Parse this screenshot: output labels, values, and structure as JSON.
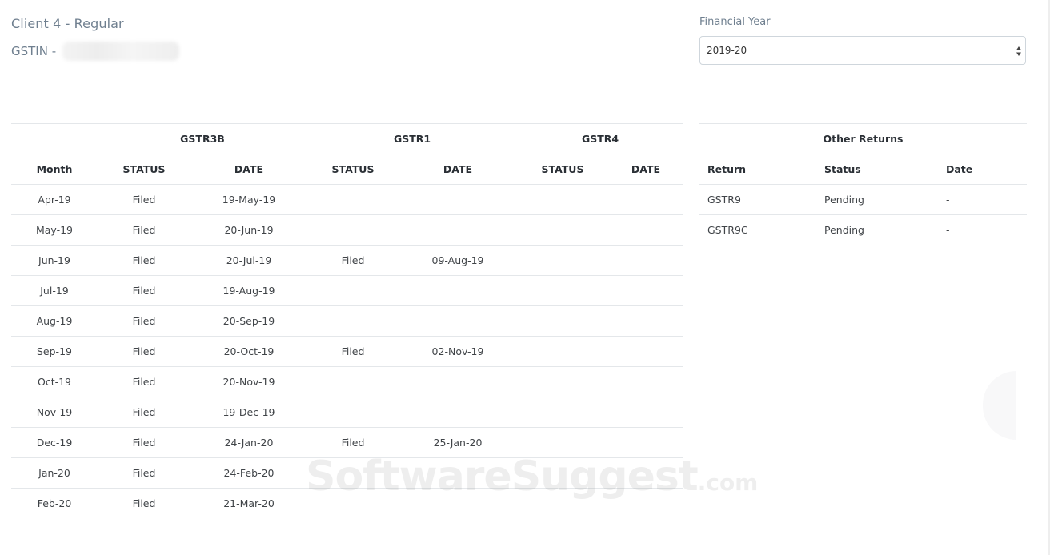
{
  "client": {
    "title": "Client 4 - Regular",
    "gstin_label": "GSTIN -"
  },
  "financial_year": {
    "label": "Financial Year",
    "selected": "2019-20"
  },
  "gst_table": {
    "groups": [
      "GSTR3B",
      "GSTR1",
      "GSTR4"
    ],
    "columns": [
      "Month",
      "STATUS",
      "DATE",
      "STATUS",
      "DATE",
      "STATUS",
      "DATE"
    ],
    "rows": [
      [
        "Apr-19",
        "Filed",
        "19-May-19",
        "",
        "",
        "",
        ""
      ],
      [
        "May-19",
        "Filed",
        "20-Jun-19",
        "",
        "",
        "",
        ""
      ],
      [
        "Jun-19",
        "Filed",
        "20-Jul-19",
        "Filed",
        "09-Aug-19",
        "",
        ""
      ],
      [
        "Jul-19",
        "Filed",
        "19-Aug-19",
        "",
        "",
        "",
        ""
      ],
      [
        "Aug-19",
        "Filed",
        "20-Sep-19",
        "",
        "",
        "",
        ""
      ],
      [
        "Sep-19",
        "Filed",
        "20-Oct-19",
        "Filed",
        "02-Nov-19",
        "",
        ""
      ],
      [
        "Oct-19",
        "Filed",
        "20-Nov-19",
        "",
        "",
        "",
        ""
      ],
      [
        "Nov-19",
        "Filed",
        "19-Dec-19",
        "",
        "",
        "",
        ""
      ],
      [
        "Dec-19",
        "Filed",
        "24-Jan-20",
        "Filed",
        "25-Jan-20",
        "",
        ""
      ],
      [
        "Jan-20",
        "Filed",
        "24-Feb-20",
        "",
        "",
        "",
        ""
      ],
      [
        "Feb-20",
        "Filed",
        "21-Mar-20",
        "",
        "",
        "",
        ""
      ]
    ]
  },
  "other_returns": {
    "title": "Other Returns",
    "columns": [
      "Return",
      "Status",
      "Date"
    ],
    "rows": [
      [
        "GSTR9",
        "Pending",
        "-"
      ],
      [
        "GSTR9C",
        "Pending",
        "-"
      ]
    ]
  },
  "watermark": {
    "main": "SoftwareSuggest",
    "suffix": ".com"
  },
  "icons": {
    "select_arrows": "sort-arrows-icon"
  }
}
